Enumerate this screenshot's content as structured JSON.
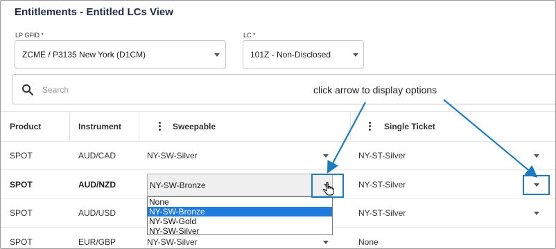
{
  "page": {
    "title": "Entitlements - Entitled LCs View"
  },
  "filters": {
    "lp_gfid": {
      "label": "LP GFID *",
      "value": "ZCME / P3135 New York (D1CM)",
      "icon": "chevron-down-icon"
    },
    "lc": {
      "label": "LC *",
      "value": "101Z - Non-Disclosed",
      "icon": "chevron-down-icon"
    }
  },
  "search": {
    "placeholder": "Search",
    "icon": "search-icon"
  },
  "annotation": {
    "text": "click arrow to display options",
    "color": "#1b7bbf"
  },
  "table": {
    "columns": {
      "product": "Product",
      "instrument": "Instrument",
      "sweepable": "Sweepable",
      "single_ticket": "Single Ticket"
    },
    "rows": [
      {
        "product": "SPOT",
        "instrument": "AUD/CAD",
        "sweepable": "NY-SW-Silver",
        "single_ticket": "NY-ST-Silver"
      },
      {
        "product": "SPOT",
        "instrument": "AUD/NZD",
        "sweepable": "NY-SW-Bronze",
        "single_ticket": "NY-ST-Silver"
      },
      {
        "product": "SPOT",
        "instrument": "AUD/USD",
        "sweepable": "",
        "single_ticket": "NY-ST-Silver"
      },
      {
        "product": "SPOT",
        "instrument": "EUR/GBP",
        "sweepable": "NY-SW-Silver",
        "single_ticket": "None"
      }
    ]
  },
  "dropdown": {
    "options": [
      "None",
      "NY-SW-Bronze",
      "NY-SW-Gold",
      "NY-SW-Silver"
    ],
    "selected": "NY-SW-Bronze",
    "highlight_color": "#1e7adf"
  }
}
